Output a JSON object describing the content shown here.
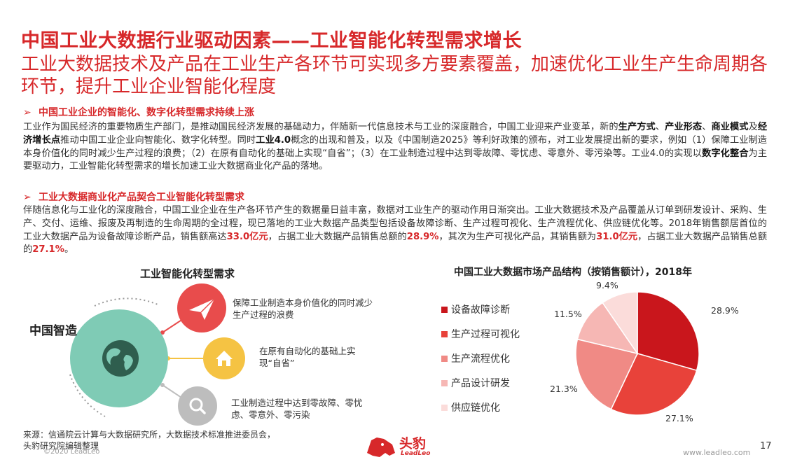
{
  "header": {
    "title": "中国工业大数据行业驱动因素——工业智能化转型需求增长",
    "subtitle": "工业大数据技术及产品在工业生产各环节可实现多方要素覆盖，加速优化工业生产生命周期各环节，提升工业企业智能化程度"
  },
  "section1": {
    "arrow": "➢",
    "heading": "中国工业企业的智能化、数字化转型需求持续上涨",
    "p1": "工业作为国民经济的重要物质生产部门，是推动国民经济发展的基础动力，伴随新一代信息技术与工业的深度融合，中国工业迎来产业变革，新的",
    "b1": "生产方式",
    "s1": "、",
    "b2": "产业形态",
    "s2": "、",
    "b3": "商业模式",
    "s3": "及",
    "b4": "经济增长点",
    "p2": "推动中国工业企业向智能化、数字化转型。同时",
    "b5": "工业4.0",
    "p3": "概念的出现和普及，以及《中国制造2025》等利好政策的颁布，对工业发展提出新的要求，例如（1）保障工业制造本身价值化的同时减少生产过程的浪费；（2）在原有自动化的基础上实现“自省”；（3）在工业制造过程中达到零故障、零忧虑、零意外、零污染等。工业4.0的实现以",
    "b6": "数字化整合",
    "p4": "为主要驱动力，工业智能化转型需求的增长加速工业大数据商业化产品的落地。"
  },
  "section2": {
    "arrow": "➢",
    "heading": "工业大数据商业化产品契合工业智能化转型需求",
    "p1": "伴随信息化与工业化的深度融合，中国工业企业在生产各环节产生的数据量日益丰富，数据对工业生产的驱动作用日渐突出。工业大数据技术及产品覆盖从订单到研发设计、采购、生产、交付、运维、报废及再制造的生命周期的全过程，现已落地的工业大数据产品类型包括设备故障诊断、生产过程可视化、生产流程优化、供应链优化等。2018年销售额居首位的工业大数据产品为设备故障诊断产品，销售额高达",
    "h1": "33.0亿元",
    "p2": "，占据工业大数据产品销售总额的",
    "h2": "28.9%",
    "p3": "，其次为生产可视化产品，其销售额为",
    "h3": "31.0亿元",
    "p4": "，占据工业大数据产品销售总额的",
    "h4": "27.1%",
    "p5": "。"
  },
  "diagram": {
    "title": "工业智能化转型需求",
    "center_label": "中国智造",
    "items": [
      {
        "text": "保障工业制造本身价值化的同时减少生产过程的浪费",
        "icon": "paper-plane-icon",
        "color": "#e84c4c"
      },
      {
        "text": "在原有自动化的基础上实现“自省”",
        "icon": "house-icon",
        "color": "#f5c343"
      },
      {
        "text": "工业制造过程中达到零故障、零忧虑、零意外、零污染",
        "icon": "magnifier-icon",
        "color": "#bdbdbd"
      }
    ],
    "globe_color": "#7fcbb5"
  },
  "chart_data": {
    "type": "pie",
    "title": "中国工业大数据市场产品结构（按销售额计），2018年",
    "series": [
      {
        "name": "设备故障诊断",
        "value": 28.9,
        "label": "28.9%",
        "color": "#c9161c"
      },
      {
        "name": "生产过程可视化",
        "value": 27.1,
        "label": "27.1%",
        "color": "#e8423a"
      },
      {
        "name": "生产流程优化",
        "value": 21.3,
        "label": "21.3%",
        "color": "#f08a85"
      },
      {
        "name": "产品设计研发",
        "value": 11.5,
        "label": "11.5%",
        "color": "#f6b7b4"
      },
      {
        "name": "供应链优化",
        "value": 9.4,
        "label": "9.4%",
        "color": "#fbdcda"
      }
    ],
    "legend_position": "left"
  },
  "footer": {
    "source_line1": "来源：信通院云计算与大数据研究所，大数据技术标准推进委员会，",
    "source_line2": "头豹研究院编辑整理",
    "copyright": "©2020 LeadLeo",
    "logo_text": "头豹",
    "logo_sub": "LeadLeo",
    "site": "www.leadleo.com",
    "page_number": "17"
  },
  "colors": {
    "accent": "#d7282a"
  }
}
